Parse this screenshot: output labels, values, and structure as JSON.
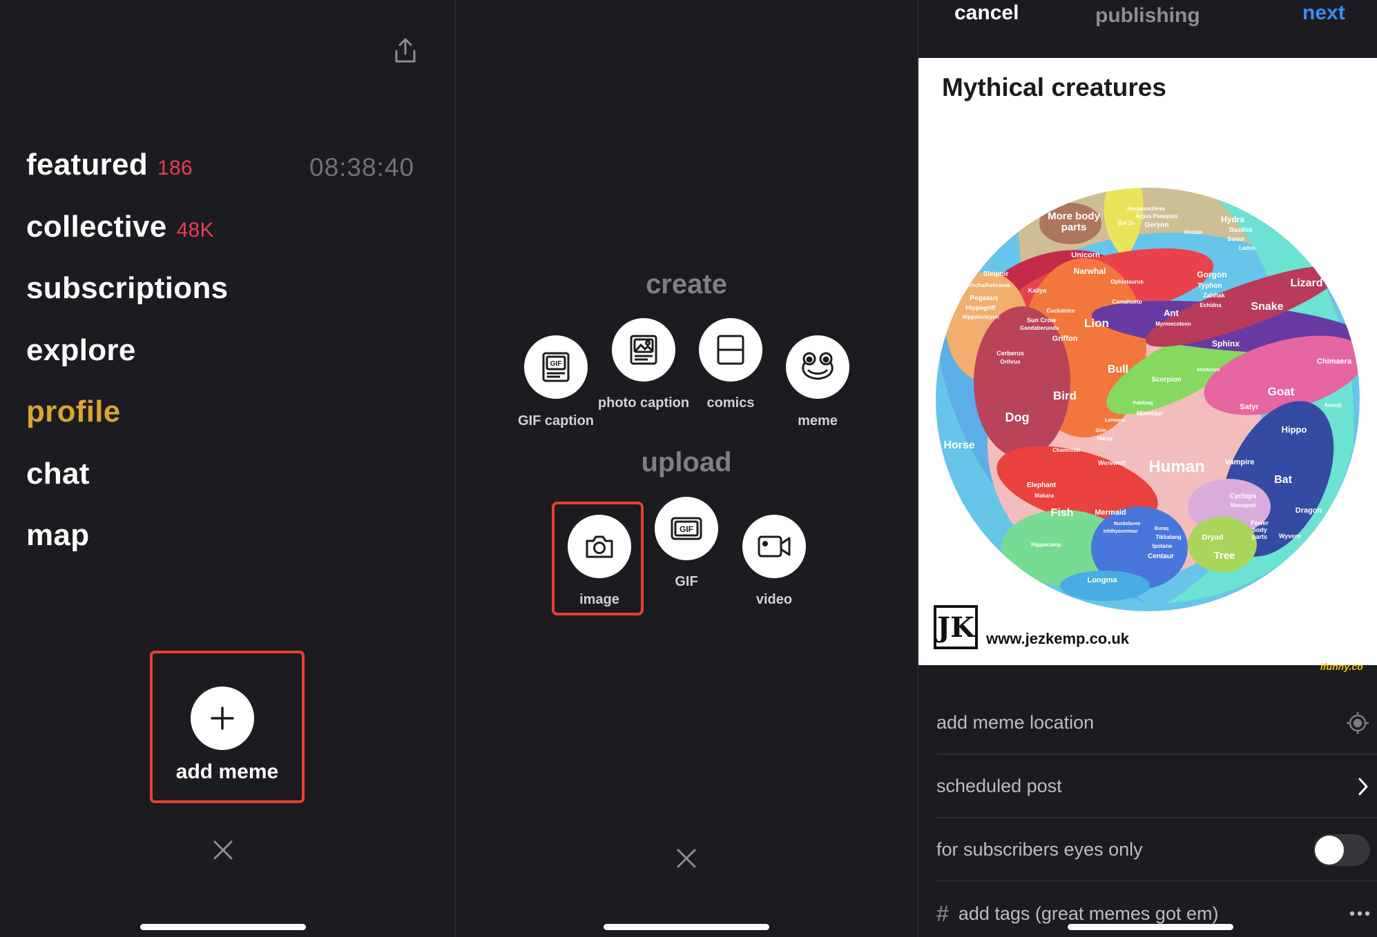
{
  "menu": {
    "items": [
      {
        "label": "featured",
        "count": "186"
      },
      {
        "label": "collective",
        "count": "48K"
      },
      {
        "label": "subscriptions",
        "count": ""
      },
      {
        "label": "explore",
        "count": ""
      },
      {
        "label": "profile",
        "count": ""
      },
      {
        "label": "chat",
        "count": ""
      },
      {
        "label": "map",
        "count": ""
      }
    ],
    "timer": "08:38:40",
    "add_meme_label": "add meme",
    "colors": {
      "count": "#ec3d55",
      "profile": "#d9a530",
      "highlight": "#e8402f"
    }
  },
  "create": {
    "create_title": "create",
    "upload_title": "upload",
    "create_options": [
      {
        "label": "GIF caption",
        "icon": "gif-caption-icon"
      },
      {
        "label": "photo caption",
        "icon": "photo-caption-icon"
      },
      {
        "label": "comics",
        "icon": "comics-icon"
      },
      {
        "label": "meme",
        "icon": "frog-meme-icon"
      }
    ],
    "upload_options": [
      {
        "label": "image",
        "icon": "camera-icon"
      },
      {
        "label": "GIF",
        "icon": "gif-icon"
      },
      {
        "label": "video",
        "icon": "video-camera-icon"
      }
    ]
  },
  "publish": {
    "cancel": "cancel",
    "title": "publishing",
    "next": "next",
    "next_color": "#3a8ef6",
    "meme": {
      "title": "Mythical creatures",
      "credit": "www.jezkemp.co.uk",
      "logo": "JK",
      "watermark": "ifunny.co",
      "labels": [
        "More body parts",
        "Hecatonchires",
        "Argus Panoptes",
        "Geryon",
        "Bai Ze",
        "Hecate",
        "Hydra",
        "Basilisk",
        "Balaur",
        "Ladon",
        "Unicorn",
        "Narwhal",
        "Sleipnir",
        "Uchchaihshravas",
        "Kaliya",
        "Ophiotaurus",
        "Gorgon",
        "Typhon",
        "Zahhak",
        "Lizard",
        "Pegasus",
        "Hippogriff",
        "Hippalectryon",
        "Cockatrice",
        "Camahueto",
        "Echidna",
        "Snake",
        "Sun Crow",
        "Gandaberunda",
        "Lion",
        "Ant",
        "Myrmecoleon",
        "Griffon",
        "Sphinx",
        "Chimaera",
        "Cerberus",
        "Orthrus",
        "Bull",
        "Manticore",
        "Bird",
        "Scorpion",
        "Goat",
        "Dog",
        "Pabilsag",
        "Minotaur",
        "Satyr",
        "Ammit",
        "Lamassu",
        "Sirin",
        "Harpy",
        "Hippo",
        "Horse",
        "Chamrosh",
        "Werewolf",
        "Human",
        "Vampire",
        "Bat",
        "Elephant",
        "Makara",
        "Cyclops",
        "Monopod",
        "Fish",
        "Mermaid",
        "Nuckelavee",
        "Ichthyocentaur",
        "Buraq",
        "Tikbalang",
        "Ipotane",
        "Centaur",
        "Dryad",
        "Fewer body parts",
        "Dragon",
        "Wyvern",
        "Hippocamp",
        "Tree",
        "Longma"
      ]
    },
    "rows": {
      "location": "add meme location",
      "scheduled": "scheduled post",
      "subscribers": "for subscribers eyes only",
      "tags_prefix": "#",
      "tags_placeholder": "add tags (great memes got em)"
    }
  }
}
